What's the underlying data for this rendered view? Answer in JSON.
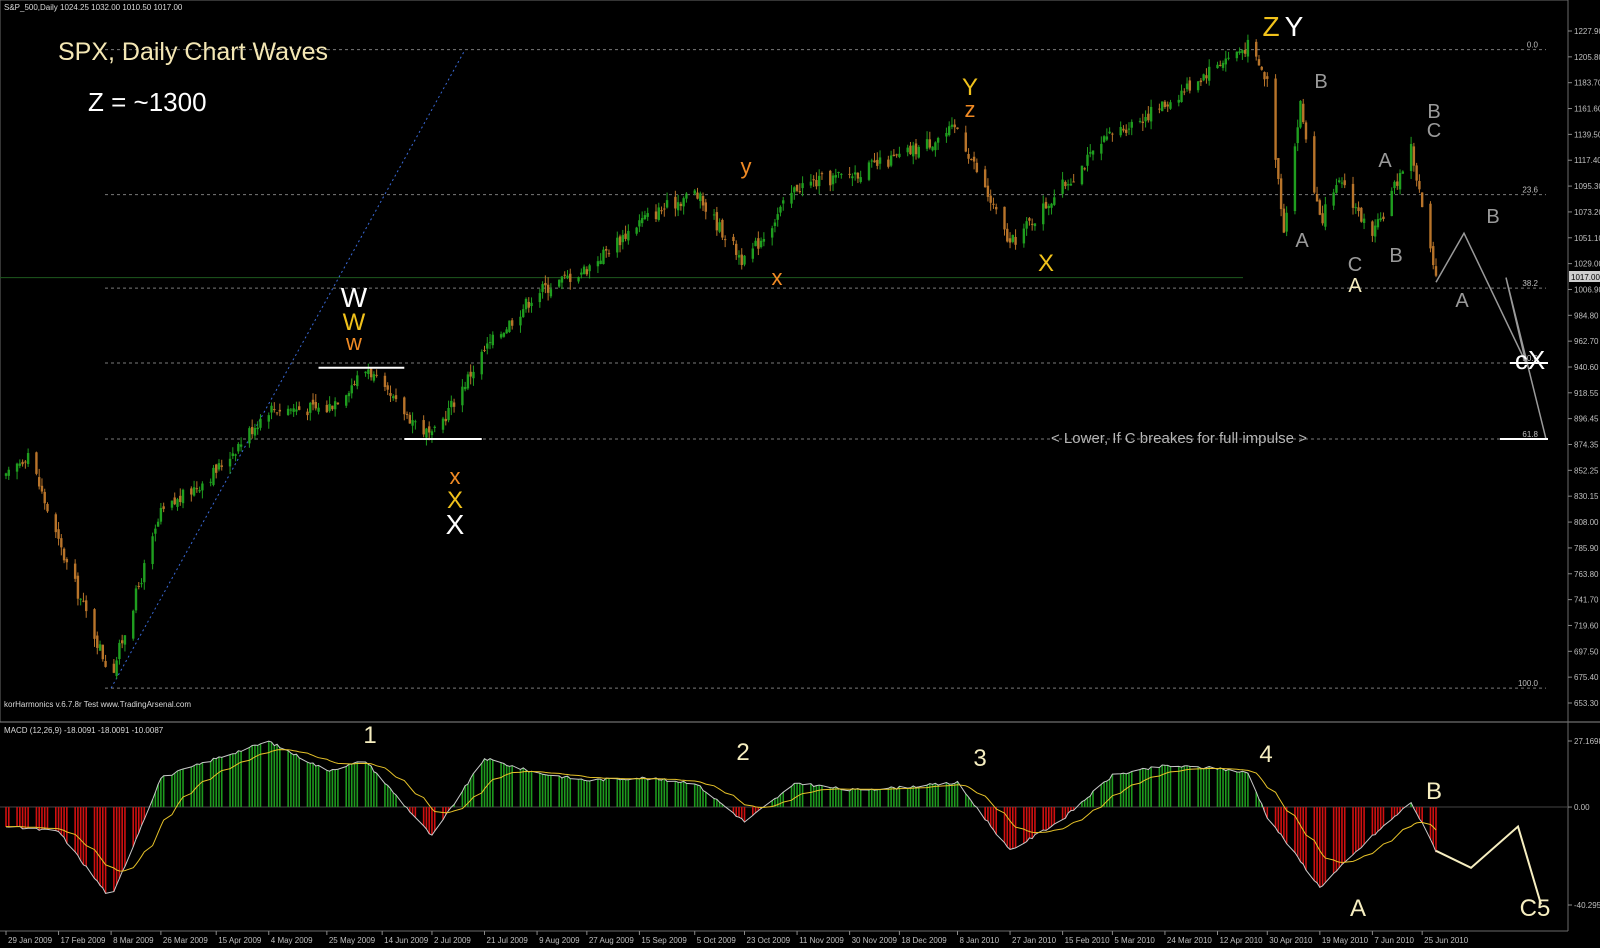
{
  "window": {
    "symbol_info": "S&P_500,Daily  1024.25 1032.00 1010.50 1017.00",
    "price_tag": "1017.00",
    "watermark": "korHarmonics v.6.7.8r Test www.TradingArsenal.com"
  },
  "annotations": {
    "title": "SPX, Daily Chart Waves",
    "target": "Z = ~1300",
    "note": "< Lower, If C breakes for full impulse >"
  },
  "colors": {
    "background": "#000000",
    "candle_up": "#1f9e1f",
    "candle_down": "#b8742a",
    "histogram_positive": "#1e9a1e",
    "histogram_negative": "#d01010",
    "signal_line": "#e6c229",
    "macd_line": "#c8c8c8",
    "trendline": "#3a6ad8",
    "wave_white": "#ffffff",
    "wave_gold": "#f1c21b",
    "wave_orange": "#f08a24",
    "wave_gray": "#9a9a9a",
    "wave_cream": "#f6eec0"
  },
  "chart_data": [
    {
      "type": "candlestick",
      "title": "SPX, Daily Chart Waves",
      "y_axis_ticks": [
        "1227.90",
        "1205.80",
        "1183.70",
        "1161.60",
        "1139.50",
        "1117.40",
        "1095.30",
        "1073.20",
        "1051.10",
        "1029.00",
        "1006.90",
        "984.80",
        "962.70",
        "940.60",
        "918.55",
        "896.45",
        "874.35",
        "852.25",
        "830.15",
        "808.00",
        "785.90",
        "763.80",
        "741.70",
        "719.60",
        "697.50",
        "675.40",
        "653.30"
      ],
      "ylim": [
        653.3,
        1227.9
      ],
      "fib_levels": [
        {
          "label": "0.0",
          "value": 1212
        },
        {
          "label": "23.6",
          "value": 1088
        },
        {
          "label": "38.2",
          "value": 1008
        },
        {
          "label": "50.0",
          "value": 944
        },
        {
          "label": "61.8",
          "value": 879
        },
        {
          "label": "100.0",
          "value": 666
        }
      ],
      "x_axis_dates": [
        "29 Jan 2009",
        "17 Feb 2009",
        "8 Mar 2009",
        "26 Mar 2009",
        "15 Apr 2009",
        "4 May 2009",
        "25 May 2009",
        "14 Jun 2009",
        "2 Jul 2009",
        "21 Jul 2009",
        "9 Aug 2009",
        "27 Aug 2009",
        "15 Sep 2009",
        "5 Oct 2009",
        "23 Oct 2009",
        "11 Nov 2009",
        "30 Nov 2009",
        "18 Dec 2009",
        "8 Jan 2010",
        "27 Jan 2010",
        "15 Feb 2010",
        "5 Mar 2010",
        "24 Mar 2010",
        "12 Apr 2010",
        "30 Apr 2010",
        "19 May 2010",
        "7 Jun 2010",
        "25 Jun 2010"
      ],
      "price_path": [
        {
          "date": "29 Jan 2009",
          "close": 845
        },
        {
          "date": "6 Feb 2009",
          "close": 868
        },
        {
          "date": "17 Feb 2009",
          "close": 790
        },
        {
          "date": "8 Mar 2009",
          "close": 676
        },
        {
          "date": "26 Mar 2009",
          "close": 815
        },
        {
          "date": "15 Apr 2009",
          "close": 852
        },
        {
          "date": "4 May 2009",
          "close": 905
        },
        {
          "date": "25 May 2009",
          "close": 905
        },
        {
          "date": "9 Jun 2009",
          "close": 940
        },
        {
          "date": "14 Jun 2009",
          "close": 920
        },
        {
          "date": "2 Jul 2009",
          "close": 880
        },
        {
          "date": "21 Jul 2009",
          "close": 955
        },
        {
          "date": "9 Aug 2009",
          "close": 1005
        },
        {
          "date": "27 Aug 2009",
          "close": 1025
        },
        {
          "date": "15 Sep 2009",
          "close": 1065
        },
        {
          "date": "5 Oct 2009",
          "close": 1090
        },
        {
          "date": "23 Oct 2009",
          "close": 1030
        },
        {
          "date": "11 Nov 2009",
          "close": 1095
        },
        {
          "date": "30 Nov 2009",
          "close": 1105
        },
        {
          "date": "18 Dec 2009",
          "close": 1120
        },
        {
          "date": "8 Jan 2010",
          "close": 1145
        },
        {
          "date": "27 Jan 2010",
          "close": 1045
        },
        {
          "date": "15 Feb 2010",
          "close": 1095
        },
        {
          "date": "5 Mar 2010",
          "close": 1140
        },
        {
          "date": "24 Mar 2010",
          "close": 1165
        },
        {
          "date": "12 Apr 2010",
          "close": 1200
        },
        {
          "date": "23 Apr 2010",
          "close": 1215
        },
        {
          "date": "30 Apr 2010",
          "close": 1185
        },
        {
          "date": "6 May 2010",
          "close": 1060
        },
        {
          "date": "12 May 2010",
          "close": 1165
        },
        {
          "date": "19 May 2010",
          "close": 1065
        },
        {
          "date": "27 May 2010",
          "close": 1100
        },
        {
          "date": "7 Jun 2010",
          "close": 1050
        },
        {
          "date": "21 Jun 2010",
          "close": 1128
        },
        {
          "date": "30 Jun 2010",
          "close": 1013
        }
      ],
      "projection": [
        {
          "label": "A",
          "value": 1013
        },
        {
          "label": "B",
          "value": 1055
        },
        {
          "label": "cX",
          "value": 944
        },
        {
          "label": "C",
          "value": 879
        }
      ],
      "wave_labels": [
        {
          "text": "W",
          "color": "white",
          "date": "9 Jun 2009"
        },
        {
          "text": "W",
          "color": "gold",
          "date": "9 Jun 2009"
        },
        {
          "text": "w",
          "color": "orange",
          "date": "9 Jun 2009"
        },
        {
          "text": "x",
          "color": "orange",
          "date": "2 Jul 2009"
        },
        {
          "text": "X",
          "color": "gold",
          "date": "2 Jul 2009"
        },
        {
          "text": "X",
          "color": "white",
          "date": "2 Jul 2009"
        },
        {
          "text": "y",
          "color": "orange",
          "date": "5 Oct 2009"
        },
        {
          "text": "x",
          "color": "orange",
          "date": "23 Oct 2009"
        },
        {
          "text": "Y",
          "color": "gold",
          "date": "8 Jan 2010"
        },
        {
          "text": "z",
          "color": "orange",
          "date": "8 Jan 2010"
        },
        {
          "text": "X",
          "color": "gold",
          "date": "27 Jan 2010"
        },
        {
          "text": "Z",
          "color": "gold",
          "date": "23 Apr 2010"
        },
        {
          "text": "Y",
          "color": "white",
          "date": "23 Apr 2010"
        },
        {
          "text": "B",
          "color": "gray",
          "date": "12 May 2010"
        },
        {
          "text": "A",
          "color": "gray",
          "date": "6 May 2010"
        },
        {
          "text": "C",
          "color": "gray",
          "date": "19 May 2010"
        },
        {
          "text": "A",
          "color": "cream",
          "date": "19 May 2010"
        },
        {
          "text": "A",
          "color": "gray",
          "date": "27 May 2010"
        },
        {
          "text": "B",
          "color": "gray",
          "date": "7 Jun 2010"
        },
        {
          "text": "B",
          "color": "gray",
          "date": "21 Jun 2010"
        },
        {
          "text": "C",
          "color": "gray",
          "date": "21 Jun 2010"
        },
        {
          "text": "A",
          "color": "gray",
          "date": "30 Jun 2010"
        },
        {
          "text": "B",
          "color": "gray",
          "date": "projection"
        },
        {
          "text": "cX",
          "color": "white",
          "date": "projection"
        }
      ]
    },
    {
      "type": "bar",
      "title": "MACD (12,26,9) -18.0091 -18.0091 -10.0087",
      "y_axis_ticks": [
        "27.1698",
        "0.00",
        "-40.2954"
      ],
      "ylim": [
        -40.2954,
        27.1698
      ],
      "histogram_path": [
        {
          "date": "29 Jan 2009",
          "value": -8
        },
        {
          "date": "17 Feb 2009",
          "value": -10
        },
        {
          "date": "8 Mar 2009",
          "value": -38
        },
        {
          "date": "26 Mar 2009",
          "value": 12
        },
        {
          "date": "15 Apr 2009",
          "value": 20
        },
        {
          "date": "4 May 2009",
          "value": 27
        },
        {
          "date": "25 May 2009",
          "value": 15
        },
        {
          "date": "8 Jun 2009",
          "value": 19
        },
        {
          "date": "2 Jul 2009",
          "value": -12
        },
        {
          "date": "21 Jul 2009",
          "value": 20
        },
        {
          "date": "9 Aug 2009",
          "value": 14
        },
        {
          "date": "27 Aug 2009",
          "value": 11
        },
        {
          "date": "15 Sep 2009",
          "value": 12
        },
        {
          "date": "5 Oct 2009",
          "value": 10
        },
        {
          "date": "23 Oct 2009",
          "value": -6
        },
        {
          "date": "11 Nov 2009",
          "value": 10
        },
        {
          "date": "30 Nov 2009",
          "value": 7
        },
        {
          "date": "18 Dec 2009",
          "value": 8
        },
        {
          "date": "8 Jan 2010",
          "value": 10
        },
        {
          "date": "27 Jan 2010",
          "value": -18
        },
        {
          "date": "15 Feb 2010",
          "value": -5
        },
        {
          "date": "5 Mar 2010",
          "value": 13
        },
        {
          "date": "24 Mar 2010",
          "value": 17
        },
        {
          "date": "12 Apr 2010",
          "value": 16
        },
        {
          "date": "23 Apr 2010",
          "value": 14
        },
        {
          "date": "30 Apr 2010",
          "value": -4
        },
        {
          "date": "19 May 2010",
          "value": -33
        },
        {
          "date": "7 Jun 2010",
          "value": -12
        },
        {
          "date": "21 Jun 2010",
          "value": 2
        },
        {
          "date": "30 Jun 2010",
          "value": -18
        }
      ],
      "wave_labels": [
        {
          "text": "1",
          "date": "8 Jun 2009"
        },
        {
          "text": "2",
          "date": "5 Oct 2009"
        },
        {
          "text": "3",
          "date": "8 Jan 2010"
        },
        {
          "text": "4",
          "date": "23 Apr 2010"
        },
        {
          "text": "A",
          "date": "19 May 2010"
        },
        {
          "text": "B",
          "date": "21 Jun 2010"
        },
        {
          "text": "C5",
          "date": "projection"
        }
      ]
    }
  ]
}
